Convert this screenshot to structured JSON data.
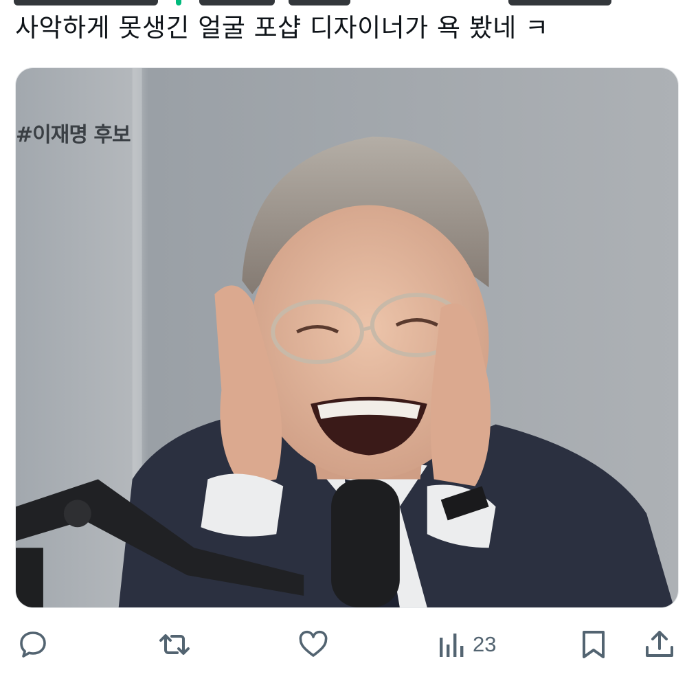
{
  "tweet": {
    "text": "사악하게 못생긴 얼굴 포샵 디자이너가 욕 봤네 ㅋ"
  },
  "media": {
    "overlay_text": "#이재명 후보",
    "colors": {
      "background": "#a8adb2",
      "suit": "#2b3040",
      "shirt": "#ecedee",
      "skin": "#e2b59c",
      "hair": "#9c948c",
      "mic": "#1d1e20"
    }
  },
  "actions": {
    "views_count": "23",
    "icons": [
      "reply-icon",
      "retweet-icon",
      "like-icon",
      "views-icon",
      "bookmark-icon",
      "share-icon"
    ],
    "icon_color": "#536471"
  }
}
